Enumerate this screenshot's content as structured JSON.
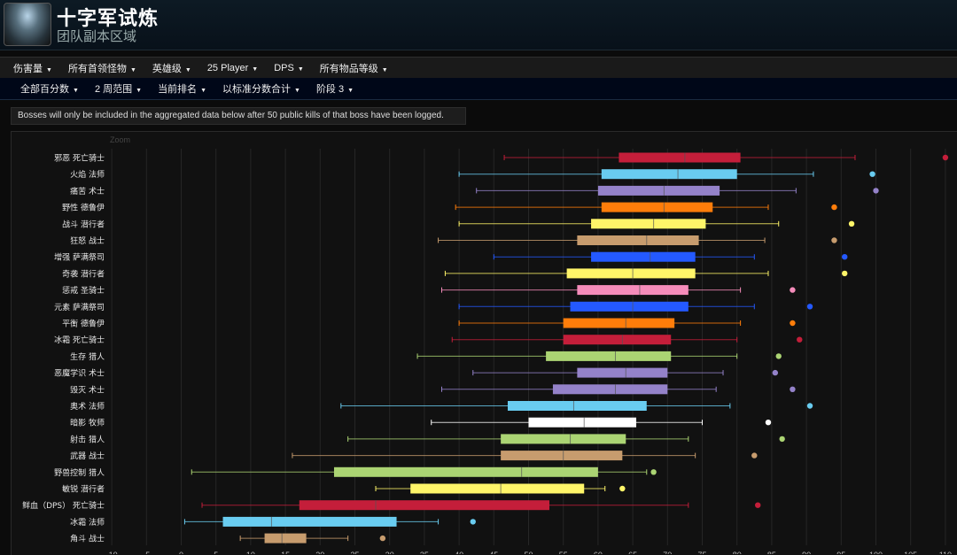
{
  "header": {
    "title": "十字军试炼",
    "subtitle": "团队副本区域"
  },
  "nav1": [
    {
      "label": "伤害量"
    },
    {
      "label": "所有首领怪物"
    },
    {
      "label": "英雄级"
    },
    {
      "label": "25 Player"
    },
    {
      "label": "DPS"
    },
    {
      "label": "所有物品等级"
    }
  ],
  "nav2": [
    {
      "label": "全部百分数"
    },
    {
      "label": "2 周范围"
    },
    {
      "label": "当前排名"
    },
    {
      "label": "以标准分数合计"
    },
    {
      "label": "阶段 3"
    }
  ],
  "notice": "Bosses will only be included in the aggregated data below after 50 public kills of that boss have been logged.",
  "zoom_label": "Zoom",
  "chart_data": {
    "type": "boxplot",
    "xlim": [
      -10,
      110
    ],
    "xticks": [
      -10,
      -5,
      0,
      5,
      10,
      15,
      20,
      25,
      30,
      35,
      40,
      45,
      50,
      55,
      60,
      65,
      70,
      75,
      80,
      85,
      90,
      95,
      100,
      105,
      110
    ],
    "grid": true,
    "series": [
      {
        "label": "邪恶 死亡骑士",
        "color": "#c41e3a",
        "min": 46.5,
        "q1": 63,
        "median": 72.5,
        "q3": 80.5,
        "max": 97,
        "outlier": 110
      },
      {
        "label": "火焰 法师",
        "color": "#69ccf0",
        "min": 40,
        "q1": 60.5,
        "median": 71.5,
        "q3": 80,
        "max": 91,
        "outlier": 99.5
      },
      {
        "label": "痛苦 术士",
        "color": "#9482c9",
        "min": 42.5,
        "q1": 60,
        "median": 69.5,
        "q3": 77.5,
        "max": 88.5,
        "outlier": 100
      },
      {
        "label": "野性 德鲁伊",
        "color": "#ff7d0a",
        "min": 39.5,
        "q1": 60.5,
        "median": 69.5,
        "q3": 76.5,
        "max": 84.5,
        "outlier": 94
      },
      {
        "label": "战斗 潜行者",
        "color": "#fff569",
        "min": 40,
        "q1": 59,
        "median": 68,
        "q3": 75.5,
        "max": 86,
        "outlier": 96.5
      },
      {
        "label": "狂怒 战士",
        "color": "#c79c6e",
        "min": 37,
        "q1": 57,
        "median": 67,
        "q3": 74.5,
        "max": 84,
        "outlier": 94
      },
      {
        "label": "增强 萨满祭司",
        "color": "#2459ff",
        "min": 45,
        "q1": 59,
        "median": 67.5,
        "q3": 74,
        "max": 82.5,
        "outlier": 95.5
      },
      {
        "label": "奇袭 潜行者",
        "color": "#fff569",
        "min": 38,
        "q1": 55.5,
        "median": 65,
        "q3": 74,
        "max": 84.5,
        "outlier": 95.5
      },
      {
        "label": "惩戒 圣骑士",
        "color": "#f58cba",
        "min": 37.5,
        "q1": 57,
        "median": 66,
        "q3": 73,
        "max": 80.5,
        "outlier": 88
      },
      {
        "label": "元素 萨满祭司",
        "color": "#2459ff",
        "min": 40,
        "q1": 56,
        "median": 65,
        "q3": 73,
        "max": 82.5,
        "outlier": 90.5
      },
      {
        "label": "平衡 德鲁伊",
        "color": "#ff7d0a",
        "min": 40,
        "q1": 55,
        "median": 64,
        "q3": 71,
        "max": 80.5,
        "outlier": 88
      },
      {
        "label": "冰霜 死亡骑士",
        "color": "#c41e3a",
        "min": 39,
        "q1": 55,
        "median": 63.5,
        "q3": 70.5,
        "max": 80,
        "outlier": 89
      },
      {
        "label": "生存 猎人",
        "color": "#abd473",
        "min": 34,
        "q1": 52.5,
        "median": 62.5,
        "q3": 70.5,
        "max": 80,
        "outlier": 86
      },
      {
        "label": "恶魔学识 术士",
        "color": "#9482c9",
        "min": 42,
        "q1": 57,
        "median": 64,
        "q3": 70,
        "max": 78,
        "outlier": 85.5
      },
      {
        "label": "毁灭 术士",
        "color": "#9482c9",
        "min": 37.5,
        "q1": 53.5,
        "median": 62.5,
        "q3": 70,
        "max": 77,
        "outlier": 88
      },
      {
        "label": "奥术 法师",
        "color": "#69ccf0",
        "min": 23,
        "q1": 47,
        "median": 56.5,
        "q3": 67,
        "max": 79,
        "outlier": 90.5
      },
      {
        "label": "暗影 牧师",
        "color": "#ffffff",
        "min": 36,
        "q1": 50,
        "median": 58,
        "q3": 65.5,
        "max": 75,
        "outlier": 84.5
      },
      {
        "label": "射击 猎人",
        "color": "#abd473",
        "min": 24,
        "q1": 46,
        "median": 56,
        "q3": 64,
        "max": 73,
        "outlier": 86.5
      },
      {
        "label": "武器 战士",
        "color": "#c79c6e",
        "min": 16,
        "q1": 46,
        "median": 55,
        "q3": 63.5,
        "max": 74,
        "outlier": 82.5
      },
      {
        "label": "野兽控制 猎人",
        "color": "#abd473",
        "min": 1.5,
        "q1": 22,
        "median": 49,
        "q3": 60,
        "max": 67,
        "outlier": 68
      },
      {
        "label": "敏锐 潜行者",
        "color": "#fff569",
        "min": 28,
        "q1": 33,
        "median": 46,
        "q3": 58,
        "max": 61,
        "outlier": 63.5
      },
      {
        "label": "鲜血（DPS） 死亡骑士",
        "color": "#c41e3a",
        "min": 3,
        "q1": 17,
        "median": 28,
        "q3": 53,
        "max": 73,
        "outlier": 83
      },
      {
        "label": "冰霜 法师",
        "color": "#69ccf0",
        "min": 0.5,
        "q1": 6,
        "median": 13,
        "q3": 31,
        "max": 37,
        "outlier": 42
      },
      {
        "label": "角斗 战士",
        "color": "#c79c6e",
        "min": 8.5,
        "q1": 12,
        "median": 14.5,
        "q3": 18,
        "max": 24,
        "outlier": 29
      }
    ]
  }
}
